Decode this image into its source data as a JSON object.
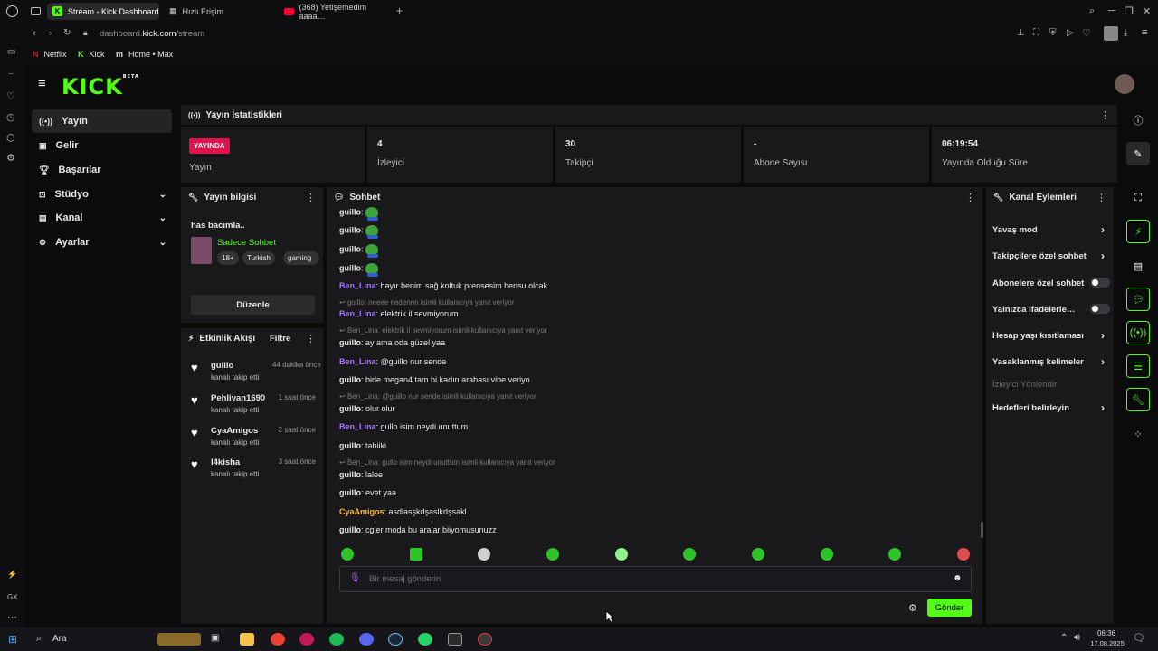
{
  "browser": {
    "tabs": [
      {
        "label": "Stream - Kick Dashboard",
        "active": true
      },
      {
        "label": "Hızlı Erişim",
        "active": false
      },
      {
        "label": "(368) Yetişemedim aaaa…",
        "active": false
      }
    ],
    "url_prefix": "dashboard.",
    "url_domain": "kick.com",
    "url_path": "/stream",
    "bookmarks": [
      "Netflix",
      "Kick",
      "Home • Max"
    ]
  },
  "kick": {
    "logo": "KICK",
    "logo_badge": "BETA"
  },
  "nav": {
    "items": [
      {
        "label": "Yayın",
        "active": true
      },
      {
        "label": "Gelir"
      },
      {
        "label": "Başarılar"
      },
      {
        "label": "Stüdyo",
        "expandable": true
      },
      {
        "label": "Kanal",
        "expandable": true
      },
      {
        "label": "Ayarlar",
        "expandable": true
      }
    ]
  },
  "stats": {
    "title": "Yayın İstatistikleri",
    "live_badge": "YAYINDA",
    "live_label": "Yayın",
    "items": [
      {
        "value": "4",
        "label": "İzleyici"
      },
      {
        "value": "30",
        "label": "Takipçi"
      },
      {
        "value": "-",
        "label": "Abone Sayısı"
      },
      {
        "value": "06:19:54",
        "label": "Yayında Olduğu Süre"
      }
    ]
  },
  "stream_info": {
    "title": "Yayın bilgisi",
    "stream_title": "has bacımla..",
    "category": "Sadece Sohbet",
    "tags": [
      "18+",
      "Turkish",
      "gaming"
    ],
    "edit_button": "Düzenle"
  },
  "activity": {
    "title": "Etkinlik Akışı",
    "filter": "Filtre",
    "events": [
      {
        "user": "guillo",
        "action": "kanalı takip etti",
        "time": "44 dakika önce"
      },
      {
        "user": "Pehlivan1690",
        "action": "kanalı takip etti",
        "time": "1 saat önce"
      },
      {
        "user": "CyaAmigos",
        "action": "kanalı takip etti",
        "time": "2 saat önce"
      },
      {
        "user": "l4kisha",
        "action": "kanalı takip etti",
        "time": "3 saat önce"
      }
    ]
  },
  "chat": {
    "title": "Sohbet",
    "messages": [
      {
        "user": "guillo",
        "text": "",
        "emote": true,
        "color": "g"
      },
      {
        "user": "guillo",
        "text": "",
        "emote": true,
        "color": "g"
      },
      {
        "user": "guillo",
        "text": "",
        "emote": true,
        "color": "g"
      },
      {
        "user": "guillo",
        "text": "",
        "emote": true,
        "color": "g"
      },
      {
        "user": "Ben_Lina",
        "text": "hayır benim sağ koltuk prensesim bensu olcak",
        "color": "p"
      },
      {
        "reply": "guillo: neeee nedennn isimli kullanıcıya yanıt veriyor"
      },
      {
        "user": "Ben_Lina",
        "text": "elektrik il sevmiyorum",
        "color": "p"
      },
      {
        "reply": "Ben_Lina: elektrik il sevmiyorum isimli kullanıcıya yanıt veriyor"
      },
      {
        "user": "guillo",
        "text": "ay ama oda güzel yaa",
        "color": "g"
      },
      {
        "user": "Ben_Lina",
        "text": "@guillo nur sende",
        "color": "p"
      },
      {
        "user": "guillo",
        "text": "bide megan4 tam bi kadın arabası vibe veriyo",
        "color": "g"
      },
      {
        "reply": "Ben_Lina: @guillo nur sende isimli kullanıcıya yanıt veriyor"
      },
      {
        "user": "guillo",
        "text": "olur olur",
        "color": "g"
      },
      {
        "user": "Ben_Lina",
        "text": "gullo isim neydi unuttum",
        "color": "p"
      },
      {
        "user": "guillo",
        "text": "tabiiki",
        "color": "g"
      },
      {
        "reply": "Ben_Lina: gullo isim neydi unuttum isimli kullanıcıya yanıt veriyor"
      },
      {
        "user": "guillo",
        "text": "lalee",
        "color": "g"
      },
      {
        "user": "guillo",
        "text": "evet yaa",
        "color": "g"
      },
      {
        "user": "CyaAmigos",
        "text": "asdlasşkdşaslkdşsakl",
        "color": "o"
      },
      {
        "user": "guillo",
        "text": "cgler moda bu aralar biiyomusunuzz",
        "color": "g"
      }
    ],
    "input_placeholder": "Bir mesaj gönderin",
    "send_button": "Gönder"
  },
  "channel_actions": {
    "title": "Kanal Eylemleri",
    "items": [
      {
        "label": "Yavaş mod",
        "type": "arrow"
      },
      {
        "label": "Takipçilere özel sohbet",
        "type": "arrow"
      },
      {
        "label": "Abonelere özel sohbet",
        "type": "toggle"
      },
      {
        "label": "Yalnızca ifadelerle…",
        "type": "toggle"
      },
      {
        "label": "Hesap yaşı kısıtlaması",
        "type": "arrow"
      },
      {
        "label": "Yasaklanmış kelimeler",
        "type": "arrow"
      },
      {
        "label": "İzleyici Yönlendir",
        "type": "disabled"
      },
      {
        "label": "Hedefleri belirleyin",
        "type": "arrow"
      }
    ]
  },
  "taskbar": {
    "search": "Ara",
    "time": "06:36",
    "date": "17.08.2025"
  }
}
